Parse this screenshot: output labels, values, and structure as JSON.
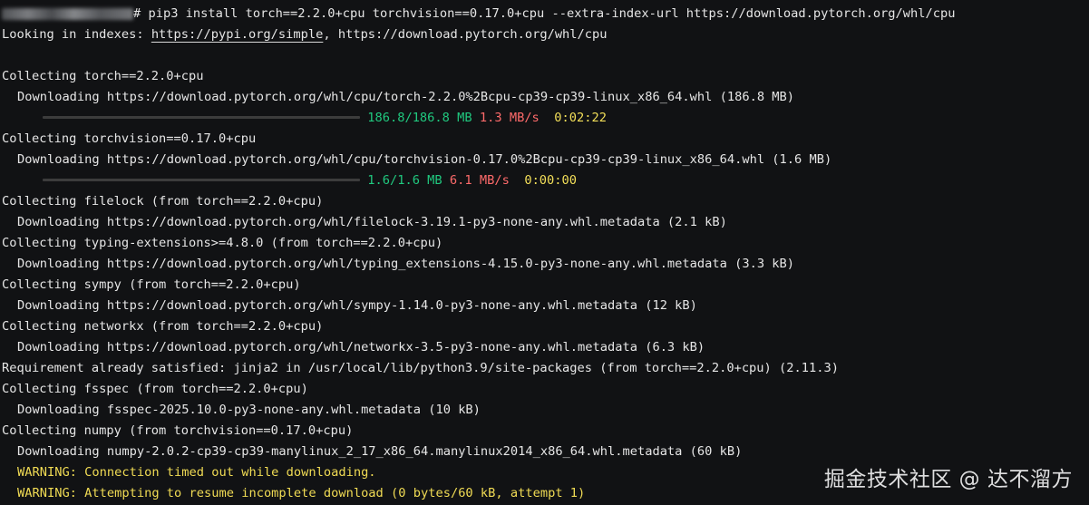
{
  "terminal": {
    "command_suffix": "# pip3 install torch==2.2.0+cpu torchvision==0.17.0+cpu --extra-index-url https://download.pytorch.org/whl/cpu",
    "looking_in_indexes_label": "Looking in indexes: ",
    "index_url_1": "https://pypi.org/simple",
    "index_url_separator": ", ",
    "index_url_2": "https://download.pytorch.org/whl/cpu",
    "collect_torch": "Collecting torch==2.2.0+cpu",
    "download_torch": "Downloading https://download.pytorch.org/whl/cpu/torch-2.2.0%2Bcpu-cp39-cp39-linux_x86_64.whl (186.8 MB)",
    "torch_progress": {
      "fraction": 1,
      "size": "186.8/186.8 MB",
      "speed": "1.3 MB/s",
      "time": "0:02:22"
    },
    "collect_torchvision": "Collecting torchvision==0.17.0+cpu",
    "download_torchvision": "Downloading https://download.pytorch.org/whl/cpu/torchvision-0.17.0%2Bcpu-cp39-cp39-linux_x86_64.whl (1.6 MB)",
    "torchvision_progress": {
      "fraction": 1,
      "size": "1.6/1.6 MB",
      "speed": "6.1 MB/s",
      "time": "0:00:00"
    },
    "collect_filelock": "Collecting filelock (from torch==2.2.0+cpu)",
    "download_filelock": "Downloading https://download.pytorch.org/whl/filelock-3.19.1-py3-none-any.whl.metadata (2.1 kB)",
    "collect_typing": "Collecting typing-extensions>=4.8.0 (from torch==2.2.0+cpu)",
    "download_typing": "Downloading https://download.pytorch.org/whl/typing_extensions-4.15.0-py3-none-any.whl.metadata (3.3 kB)",
    "collect_sympy": "Collecting sympy (from torch==2.2.0+cpu)",
    "download_sympy": "Downloading https://download.pytorch.org/whl/sympy-1.14.0-py3-none-any.whl.metadata (12 kB)",
    "collect_networkx": "Collecting networkx (from torch==2.2.0+cpu)",
    "download_networkx": "Downloading https://download.pytorch.org/whl/networkx-3.5-py3-none-any.whl.metadata (6.3 kB)",
    "requirement_jinja2": "Requirement already satisfied: jinja2 in /usr/local/lib/python3.9/site-packages (from torch==2.2.0+cpu) (2.11.3)",
    "collect_fsspec": "Collecting fsspec (from torch==2.2.0+cpu)",
    "download_fsspec": "Downloading fsspec-2025.10.0-py3-none-any.whl.metadata (10 kB)",
    "collect_numpy": "Collecting numpy (from torchvision==0.17.0+cpu)",
    "download_numpy": "Downloading numpy-2.0.2-cp39-cp39-manylinux_2_17_x86_64.manylinux2014_x86_64.whl.metadata (60 kB)",
    "warning_timeout": "WARNING: Connection timed out while downloading.",
    "warning_resume": "WARNING: Attempting to resume incomplete download (0 bytes/60 kB, attempt 1)"
  },
  "watermark": "掘金技术社区 @ 达不溜方",
  "colors": {
    "background": "#111214",
    "text": "#e6e6e6",
    "progress_size": "#20c97f",
    "progress_speed": "#ff6b6b",
    "progress_time": "#f3df59",
    "warning": "#f0db54"
  }
}
